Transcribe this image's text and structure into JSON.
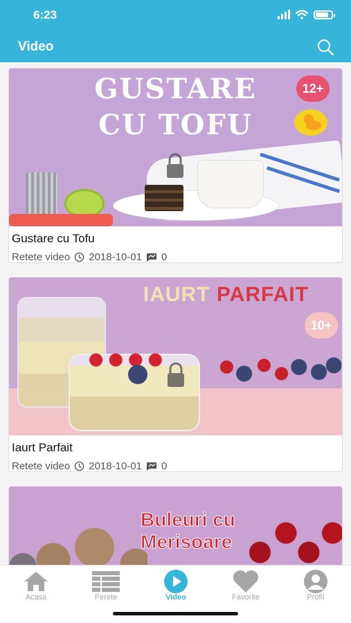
{
  "status": {
    "time": "6:23"
  },
  "header": {
    "title": "Video",
    "search_icon": "search-icon"
  },
  "videos": [
    {
      "thumb_headline_1": "GUSTARE",
      "thumb_headline_2": "CU TOFU",
      "age_badge": "12+",
      "title": "Gustare cu Tofu",
      "category": "Retete video",
      "date": "2018-10-01",
      "comments": "0"
    },
    {
      "thumb_headline_1": "IAURT",
      "thumb_headline_2": "PARFAIT",
      "age_badge": "10+",
      "title": "Iaurt Parfait",
      "category": "Retete video",
      "date": "2018-10-01",
      "comments": "0"
    },
    {
      "thumb_headline_1": "Buleuri cu",
      "thumb_headline_2": "Merisoare"
    }
  ],
  "tabs": [
    {
      "label": "Acasa",
      "icon": "home-icon"
    },
    {
      "label": "Perete",
      "icon": "wall-list-icon"
    },
    {
      "label": "Video",
      "icon": "play-icon"
    },
    {
      "label": "Favorite",
      "icon": "heart-icon"
    },
    {
      "label": "Profil",
      "icon": "profile-icon"
    }
  ],
  "colors": {
    "accent": "#37b4da",
    "inactive": "#a6a6a6",
    "badge_red": "#e8516f",
    "badge_pink": "#f6c2c2"
  }
}
